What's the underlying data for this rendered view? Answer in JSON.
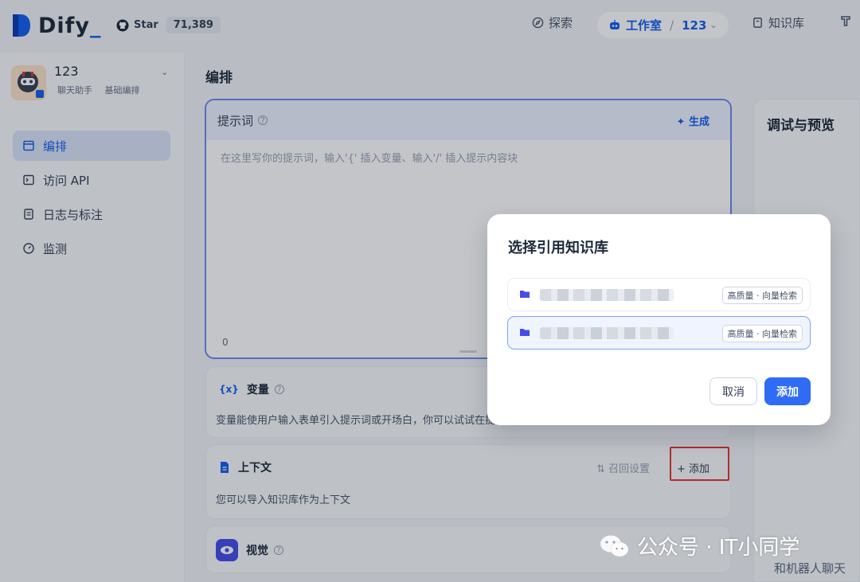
{
  "topbar": {
    "logo_text": "Dify",
    "github_label": "Star",
    "github_count": "71,389",
    "nav_explore": "探索",
    "nav_studio": "工作室",
    "nav_app": "123",
    "nav_knowledge": "知识库"
  },
  "sidebar": {
    "app_name": "123",
    "app_tags": [
      "聊天助手",
      "基础编排"
    ],
    "items": [
      {
        "label": "编排",
        "icon": "layout-icon",
        "active": true
      },
      {
        "label": "访问 API",
        "icon": "terminal-icon",
        "active": false
      },
      {
        "label": "日志与标注",
        "icon": "document-icon",
        "active": false
      },
      {
        "label": "监测",
        "icon": "gauge-icon",
        "active": false
      }
    ]
  },
  "main": {
    "title": "编排",
    "prompt": {
      "title": "提示词",
      "generate_label": "生成",
      "placeholder": "在这里写你的提示词，输入'{' 插入变量、输入'/' 插入提示内容块",
      "count": "0"
    },
    "variables": {
      "title": "变量",
      "description": "变量能使用户输入表单引入提示词或开场白，你可以试试在提"
    },
    "context": {
      "title": "上下文",
      "recall_label": "召回设置",
      "add_label": "添加",
      "description": "您可以导入知识库作为上下文"
    },
    "vision": {
      "title": "视觉"
    }
  },
  "debug": {
    "title": "调试与预览"
  },
  "modal": {
    "title": "选择引用知识库",
    "datasets": [
      {
        "tag": "高质量 · 向量检索",
        "selected": false
      },
      {
        "tag": "高质量 · 向量检索",
        "selected": true
      }
    ],
    "cancel_label": "取消",
    "add_label": "添加"
  },
  "watermark": {
    "text": "公众号 · IT小同学",
    "corner_text": "和机器人聊天"
  },
  "colors": {
    "accent": "#155eef",
    "highlight": "#e5352b",
    "primary_button": "#2f6cf6"
  }
}
